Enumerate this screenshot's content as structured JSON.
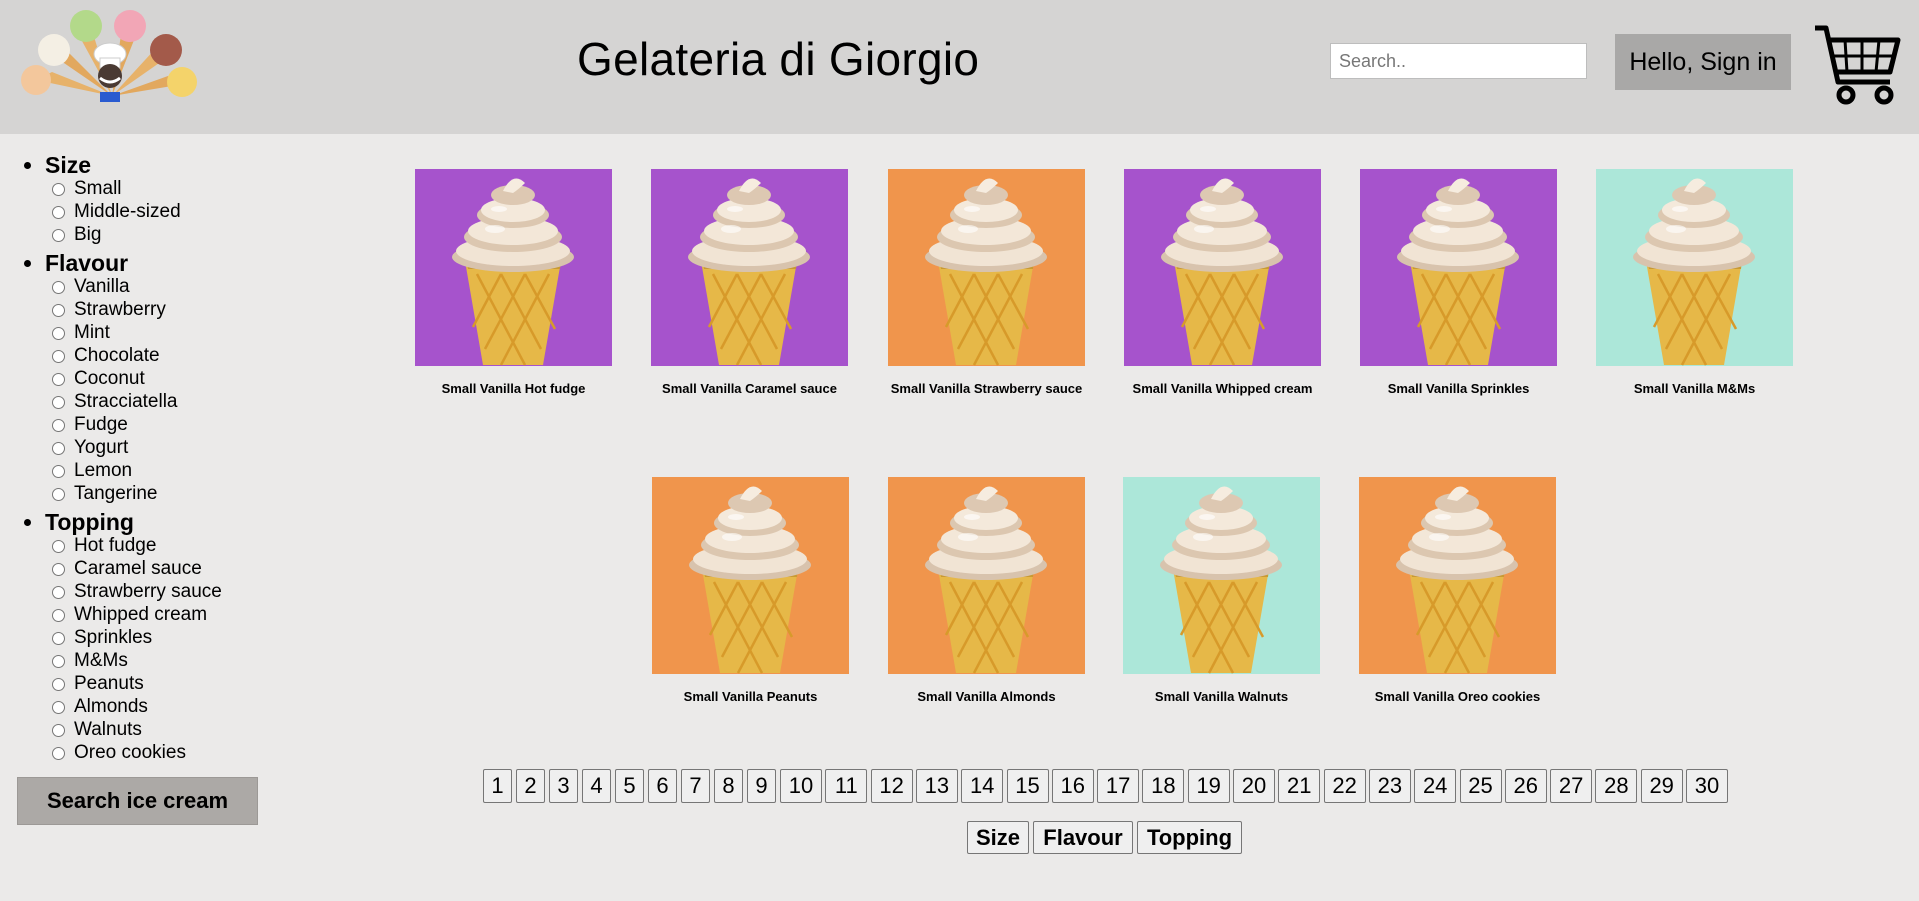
{
  "header": {
    "title": "Gelateria di Giorgio",
    "search_placeholder": "Search..",
    "signin_label": "Hello, Sign in",
    "logo_icon": "gelato-chef-logo",
    "cart_icon": "cart-icon"
  },
  "sidebar": {
    "groups": [
      {
        "title": "Size",
        "options": [
          "Small",
          "Middle-sized",
          "Big"
        ]
      },
      {
        "title": "Flavour",
        "options": [
          "Vanilla",
          "Strawberry",
          "Mint",
          "Chocolate",
          "Coconut",
          "Stracciatella",
          "Fudge",
          "Yogurt",
          "Lemon",
          "Tangerine"
        ]
      },
      {
        "title": "Topping",
        "options": [
          "Hot fudge",
          "Caramel sauce",
          "Strawberry sauce",
          "Whipped cream",
          "Sprinkles",
          "M&Ms",
          "Peanuts",
          "Almonds",
          "Walnuts",
          "Oreo cookies"
        ]
      }
    ],
    "search_button": "Search ice cream"
  },
  "products": [
    {
      "name": "Small Vanilla Hot fudge",
      "bg": "#a653cc"
    },
    {
      "name": "Small Vanilla Caramel sauce",
      "bg": "#a653cc"
    },
    {
      "name": "Small Vanilla Strawberry sauce",
      "bg": "#f0954c"
    },
    {
      "name": "Small Vanilla Whipped cream",
      "bg": "#a653cc"
    },
    {
      "name": "Small Vanilla Sprinkles",
      "bg": "#a653cc"
    },
    {
      "name": "Small Vanilla M&Ms",
      "bg": "#ace7d9"
    },
    {
      "name": "Small Vanilla Peanuts",
      "bg": "#f0954c"
    },
    {
      "name": "Small Vanilla Almonds",
      "bg": "#f0954c"
    },
    {
      "name": "Small Vanilla Walnuts",
      "bg": "#ace7d9"
    },
    {
      "name": "Small Vanilla Oreo cookies",
      "bg": "#f0954c"
    }
  ],
  "pagination": [
    "1",
    "2",
    "3",
    "4",
    "5",
    "6",
    "7",
    "8",
    "9",
    "10",
    "11",
    "12",
    "13",
    "14",
    "15",
    "16",
    "17",
    "18",
    "19",
    "20",
    "21",
    "22",
    "23",
    "24",
    "25",
    "26",
    "27",
    "28",
    "29",
    "30"
  ],
  "sort_buttons": [
    "Size",
    "Flavour",
    "Topping"
  ]
}
